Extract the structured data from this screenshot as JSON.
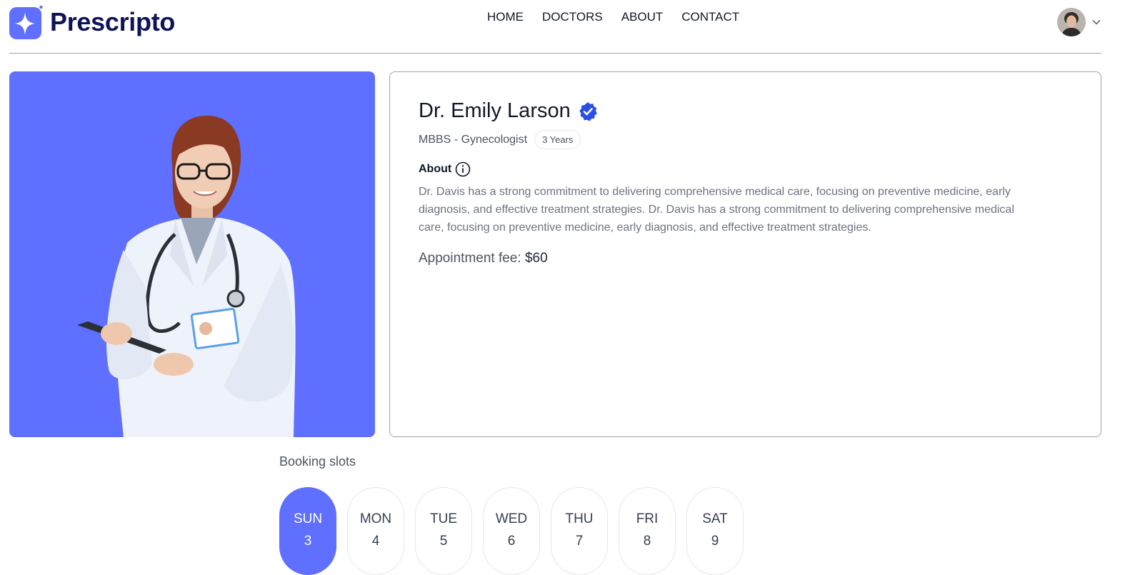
{
  "brand": {
    "name": "Prescripto",
    "color": "#5f6fff",
    "text_color": "#0f1458"
  },
  "nav": {
    "links": [
      "HOME",
      "DOCTORS",
      "ABOUT",
      "CONTACT"
    ]
  },
  "profile": {
    "avatar_icon": "user-avatar",
    "menu_icon": "chevron-down-icon"
  },
  "doctor": {
    "name": "Dr. Emily Larson",
    "verified_icon": "verified-badge-icon",
    "degree_speciality": "MBBS - Gynecologist",
    "experience": "3 Years",
    "about_label": "About",
    "about_text": "Dr. Davis has a strong commitment to delivering comprehensive medical care, focusing on preventive medicine, early diagnosis, and effective treatment strategies. Dr. Davis has a strong commitment to delivering comprehensive medical care, focusing on preventive medicine, early diagnosis, and effective treatment strategies.",
    "fee_label": "Appointment fee:",
    "fee_value": "$60",
    "image_bg": "#5f6fff"
  },
  "booking": {
    "title": "Booking slots",
    "slots": [
      {
        "day": "SUN",
        "date": "3",
        "selected": true
      },
      {
        "day": "MON",
        "date": "4",
        "selected": false
      },
      {
        "day": "TUE",
        "date": "5",
        "selected": false
      },
      {
        "day": "WED",
        "date": "6",
        "selected": false
      },
      {
        "day": "THU",
        "date": "7",
        "selected": false
      },
      {
        "day": "FRI",
        "date": "8",
        "selected": false
      },
      {
        "day": "SAT",
        "date": "9",
        "selected": false
      }
    ]
  }
}
